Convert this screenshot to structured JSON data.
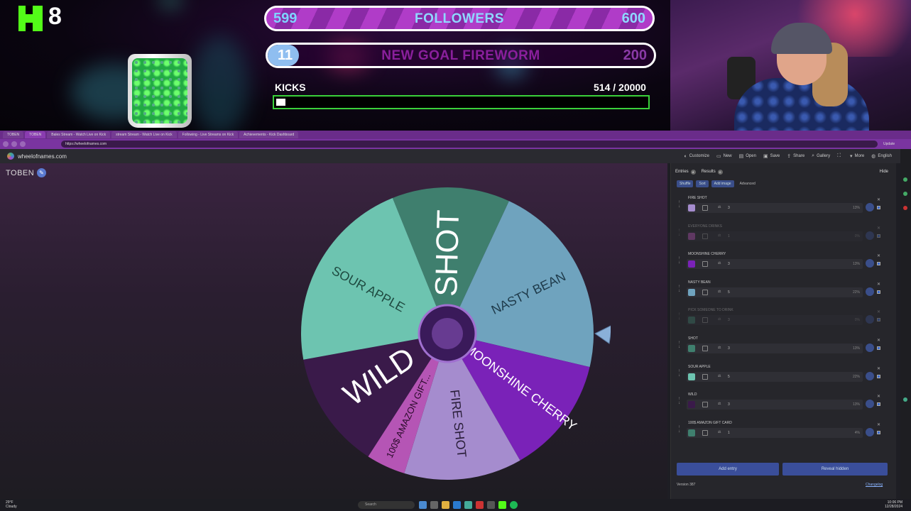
{
  "overlay": {
    "kick_count": "8",
    "goal1": {
      "left": "599",
      "title": "FOLLOWERS",
      "right": "600"
    },
    "goal2": {
      "left": "11",
      "title": "NEW GOAL FIREWORM",
      "right": "200"
    },
    "kicks": {
      "label": "KICKS",
      "value_text": "514  / 20000",
      "current": 514,
      "target": 20000
    },
    "colors": {
      "kick_green": "#53fc18",
      "goal_purple": "#b03cc8"
    }
  },
  "browser": {
    "tabs": [
      "TOBEN",
      "TOBEN",
      "Bales Stream - Watch Live on Kick",
      "stream Stream - Watch Live on Kick",
      "Following - Live Streams on Kick",
      "Achievements - Kick Dashboard"
    ],
    "url": "https://wheelofnames.com",
    "profile_label": "Update"
  },
  "site": {
    "name": "wheelofnames.com",
    "menu": [
      {
        "icon": "palette-icon",
        "label": "Customize"
      },
      {
        "icon": "file-icon",
        "label": "New"
      },
      {
        "icon": "folder-icon",
        "label": "Open"
      },
      {
        "icon": "save-icon",
        "label": "Save"
      },
      {
        "icon": "share-icon",
        "label": "Share"
      },
      {
        "icon": "search-icon",
        "label": "Gallery"
      },
      {
        "icon": "fullscreen-icon",
        "label": ""
      },
      {
        "icon": "more-icon",
        "label": "More"
      },
      {
        "icon": "globe-icon",
        "label": "English"
      }
    ]
  },
  "wheel": {
    "title": "TOBEN",
    "segments": [
      {
        "label": "SHOT",
        "color": "#3f7f6e",
        "text_color": "#ffffff",
        "size": "big"
      },
      {
        "label": "NASTY BEAN",
        "color": "#6fa3be",
        "text_color": "#1e3a4a",
        "size": "small"
      },
      {
        "label": "MOONSHINE CHERRY",
        "color": "#7a22b8",
        "text_color": "#ffffff",
        "size": "small"
      },
      {
        "label": "FIRE SHOT",
        "color": "#a58cce",
        "text_color": "#2a1e3a",
        "size": "small"
      },
      {
        "label": "100$ AMAZON GIFT...",
        "color": "#b555b5",
        "text_color": "#2a0a2a",
        "size": "tiny"
      },
      {
        "label": "WILD",
        "color": "#3a1a4a",
        "text_color": "#ffffff",
        "size": "big"
      },
      {
        "label": "SOUR APPLE",
        "color": "#6dc4b0",
        "text_color": "#1e4a40",
        "size": "small"
      }
    ],
    "weights": [
      3,
      5,
      3,
      3,
      1,
      3,
      5
    ]
  },
  "panel": {
    "tabs": [
      {
        "label": "Entries",
        "badge": "8"
      },
      {
        "label": "Results",
        "badge": "0"
      }
    ],
    "hide_label": "Hide",
    "tools": [
      "Shuffle",
      "Sort",
      "Add image"
    ],
    "advanced_label": "Advanced",
    "entries": [
      {
        "name": "FIRE SHOT",
        "weight": "3",
        "pct": "13%",
        "color": "#a58cce",
        "dim": false
      },
      {
        "name": "EVERYONE DRINKS",
        "weight": "1",
        "pct": "0%",
        "color": "#b555b5",
        "dim": true
      },
      {
        "name": "MOONSHINE CHERRY",
        "weight": "3",
        "pct": "13%",
        "color": "#7a22b8",
        "dim": false
      },
      {
        "name": "NASTY BEAN",
        "weight": "5",
        "pct": "22%",
        "color": "#6fa3be",
        "dim": false
      },
      {
        "name": "PICK SOMEONE TO DRINK",
        "weight": "3",
        "pct": "0%",
        "color": "#3f7f6e",
        "dim": true
      },
      {
        "name": "SHOT",
        "weight": "3",
        "pct": "13%",
        "color": "#3f7f6e",
        "dim": false
      },
      {
        "name": "SOUR APPLE",
        "weight": "5",
        "pct": "22%",
        "color": "#6dc4b0",
        "dim": false
      },
      {
        "name": "WILD",
        "weight": "3",
        "pct": "13%",
        "color": "#3a1a4a",
        "dim": false
      },
      {
        "name": "100$ AMAZON GIFT CARD",
        "weight": "1",
        "pct": "4%",
        "color": "#3f7f6e",
        "dim": false
      }
    ],
    "add_entry_label": "Add entry",
    "reveal_hidden_label": "Reveal hidden",
    "version": "Version 387",
    "changelog": "Changelog"
  },
  "taskbar": {
    "weather_temp": "29°F",
    "weather_desc": "Cloudy",
    "search_placeholder": "Search",
    "clock_time": "10:06 PM",
    "clock_date": "12/28/2024"
  }
}
